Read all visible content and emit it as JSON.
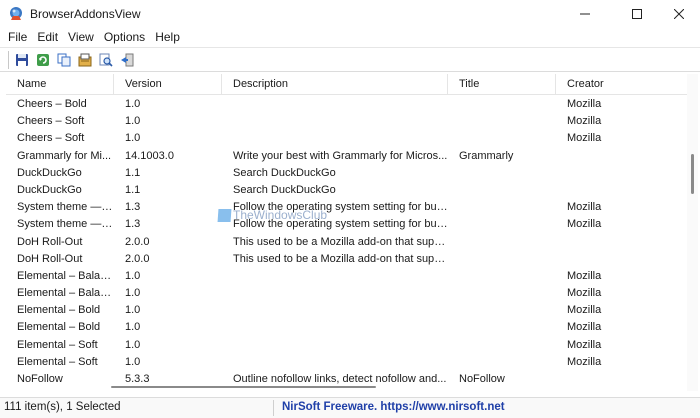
{
  "window": {
    "title": "BrowserAddonsView"
  },
  "menu": [
    "File",
    "Edit",
    "View",
    "Options",
    "Help"
  ],
  "toolbar": {
    "icons": [
      "save-icon",
      "refresh-icon",
      "copy-icon",
      "properties-icon",
      "find-icon",
      "exit-icon"
    ]
  },
  "columns": [
    "Name",
    "Version",
    "Description",
    "Title",
    "Creator"
  ],
  "rows": [
    {
      "name": "Cheers – Bold",
      "version": "1.0",
      "description": "",
      "title": "",
      "creator": "Mozilla"
    },
    {
      "name": "Cheers – Soft",
      "version": "1.0",
      "description": "",
      "title": "",
      "creator": "Mozilla"
    },
    {
      "name": "Cheers – Soft",
      "version": "1.0",
      "description": "",
      "title": "",
      "creator": "Mozilla"
    },
    {
      "name": "Grammarly for Mi...",
      "version": "14.1003.0",
      "description": "Write your best with Grammarly for Micros...",
      "title": "Grammarly",
      "creator": ""
    },
    {
      "name": "DuckDuckGo",
      "version": "1.1",
      "description": "Search DuckDuckGo",
      "title": "",
      "creator": ""
    },
    {
      "name": "DuckDuckGo",
      "version": "1.1",
      "description": "Search DuckDuckGo",
      "title": "",
      "creator": ""
    },
    {
      "name": "System theme — a...",
      "version": "1.3",
      "description": "Follow the operating system setting for but...",
      "title": "",
      "creator": "Mozilla"
    },
    {
      "name": "System theme — a...",
      "version": "1.3",
      "description": "Follow the operating system setting for but...",
      "title": "",
      "creator": "Mozilla"
    },
    {
      "name": "DoH Roll-Out",
      "version": "2.0.0",
      "description": "This used to be a Mozilla add-on that supp...",
      "title": "",
      "creator": ""
    },
    {
      "name": "DoH Roll-Out",
      "version": "2.0.0",
      "description": "This used to be a Mozilla add-on that supp...",
      "title": "",
      "creator": ""
    },
    {
      "name": "Elemental – Balanc...",
      "version": "1.0",
      "description": "",
      "title": "",
      "creator": "Mozilla"
    },
    {
      "name": "Elemental – Balanc...",
      "version": "1.0",
      "description": "",
      "title": "",
      "creator": "Mozilla"
    },
    {
      "name": "Elemental – Bold",
      "version": "1.0",
      "description": "",
      "title": "",
      "creator": "Mozilla"
    },
    {
      "name": "Elemental – Bold",
      "version": "1.0",
      "description": "",
      "title": "",
      "creator": "Mozilla"
    },
    {
      "name": "Elemental – Soft",
      "version": "1.0",
      "description": "",
      "title": "",
      "creator": "Mozilla"
    },
    {
      "name": "Elemental – Soft",
      "version": "1.0",
      "description": "",
      "title": "",
      "creator": "Mozilla"
    },
    {
      "name": "NoFollow",
      "version": "5.3.3",
      "description": "Outline nofollow links, detect nofollow and...",
      "title": "NoFollow",
      "creator": ""
    }
  ],
  "status": {
    "count": "111 item(s), 1 Selected",
    "link": "NirSoft Freeware. https://www.nirsoft.net"
  },
  "watermark": "TheWindowsClub"
}
